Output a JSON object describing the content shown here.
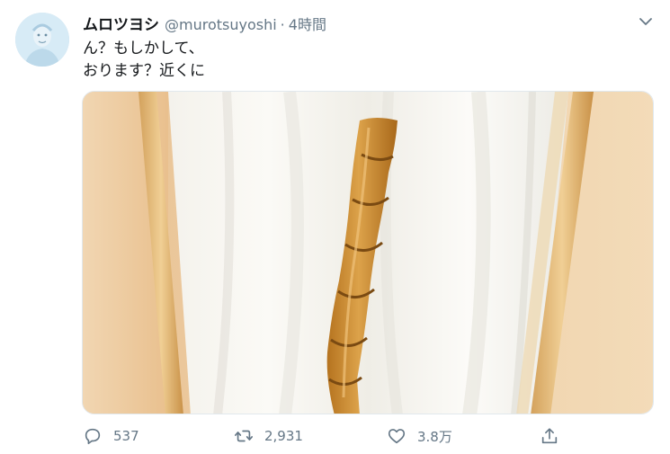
{
  "tweet": {
    "display_name": "ムロツヨシ",
    "handle": "@murotsuyoshi",
    "separator": "·",
    "time": "4時間",
    "text_lines": [
      "ん？もしかして、",
      "おります？近くに"
    ]
  },
  "actions": {
    "replies": "537",
    "retweets": "2,931",
    "likes": "3.8万"
  },
  "colors": {
    "secondary_text": "#657786",
    "primary_text": "#14171a",
    "border": "#e1e8ed"
  },
  "icons": [
    "chevron-down-icon",
    "reply-icon",
    "retweet-icon",
    "like-icon",
    "share-icon"
  ]
}
